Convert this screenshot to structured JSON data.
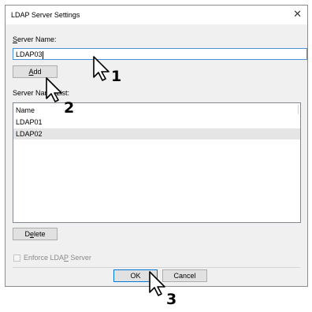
{
  "dialog": {
    "title": "LDAP Server Settings",
    "close_glyph": "✕"
  },
  "server_name": {
    "label_mnemonic": "S",
    "label_rest": "erver Name:",
    "value": "LDAP03"
  },
  "add_button": {
    "mnemonic": "A",
    "label_rest": "dd"
  },
  "server_list": {
    "label": "Server Name List:",
    "column_header": "Name",
    "rows": [
      "LDAP01",
      "LDAP02"
    ],
    "selected_index": 1
  },
  "delete_button": {
    "pre": "D",
    "mnemonic": "e",
    "post": "lete"
  },
  "enforce": {
    "pre": "Enforce LDA",
    "mnemonic": "P",
    "post": " Server",
    "checked": false,
    "enabled": false
  },
  "footer": {
    "ok_label": "OK",
    "cancel_label": "Cancel"
  },
  "annotations": {
    "cursor_1": "1",
    "cursor_2": "2",
    "cursor_3": "3"
  },
  "icons": {
    "cursor": "pointer-cursor-icon",
    "close": "close-icon"
  }
}
